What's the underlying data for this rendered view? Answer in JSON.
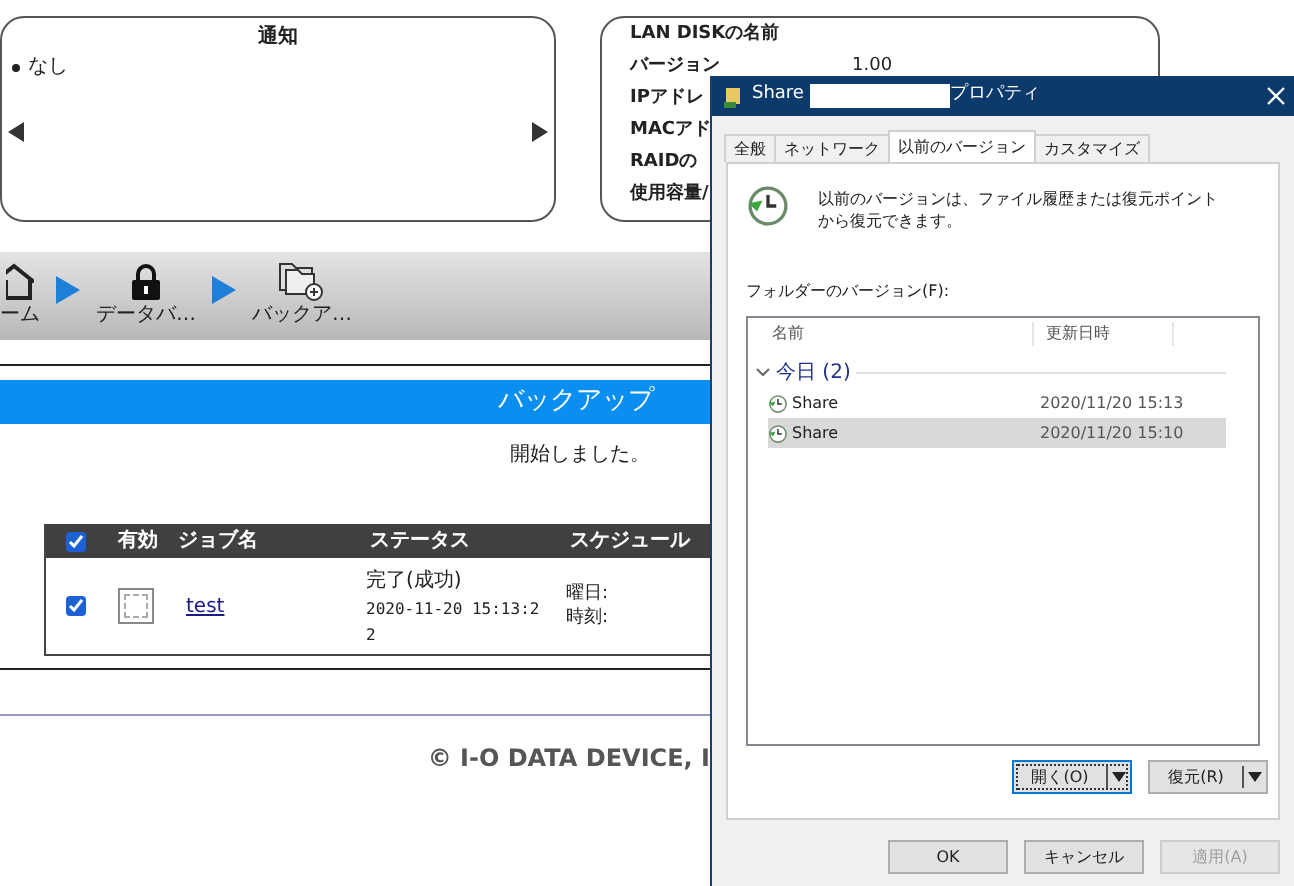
{
  "notice": {
    "title": "通知",
    "items": [
      "なし"
    ]
  },
  "info": {
    "rows": [
      {
        "label": "LAN DISKの名前"
      },
      {
        "label": "バージョン",
        "value": "1.00"
      },
      {
        "label": "IPアドレ"
      },
      {
        "label": "MACアド"
      },
      {
        "label": "RAIDの"
      },
      {
        "label": "使用容量/"
      }
    ]
  },
  "breadcrumb": [
    {
      "kind": "home",
      "label": "ーム"
    },
    {
      "kind": "lock",
      "label": "データバ…"
    },
    {
      "kind": "folder",
      "label": "バックア…"
    }
  ],
  "section_title": "バックアップ",
  "message": "開始しました。",
  "table": {
    "all_checked": true,
    "columns": [
      "有効",
      "ジョブ名",
      "ステータス",
      "スケジュール"
    ],
    "rows": [
      {
        "checked": true,
        "enabled": false,
        "job": "test",
        "status": "完了(成功)",
        "time_lines": [
          "2020-11-20 15:13:2",
          "2"
        ],
        "schedule": [
          "曜日:",
          "時刻:"
        ]
      }
    ]
  },
  "footer": "© I-O DATA DEVICE, I",
  "dialog": {
    "title_start": "Share",
    "title_end": "プロパティ",
    "tabs": [
      {
        "label": "全般",
        "selected": false
      },
      {
        "label": "ネットワーク",
        "selected": false
      },
      {
        "label": "以前のバージョン",
        "selected": true
      },
      {
        "label": "カスタマイズ",
        "selected": false
      }
    ],
    "description": "以前のバージョンは、ファイル履歴または復元ポイントから復元できます。",
    "list_label": "フォルダーのバージョン(F):",
    "columns": [
      "名前",
      "更新日時"
    ],
    "group": "今日 (2)",
    "versions": [
      {
        "name": "Share",
        "date": "2020/11/20 15:13",
        "selected": false
      },
      {
        "name": "Share",
        "date": "2020/11/20 15:10",
        "selected": true
      }
    ],
    "split_buttons": [
      {
        "label": "開く(O)",
        "focused": true
      },
      {
        "label": "復元(R)",
        "focused": false
      }
    ],
    "buttons": [
      {
        "label": "OK",
        "disabled": false
      },
      {
        "label": "キャンセル",
        "disabled": false
      },
      {
        "label": "適用(A)",
        "disabled": true
      }
    ]
  }
}
